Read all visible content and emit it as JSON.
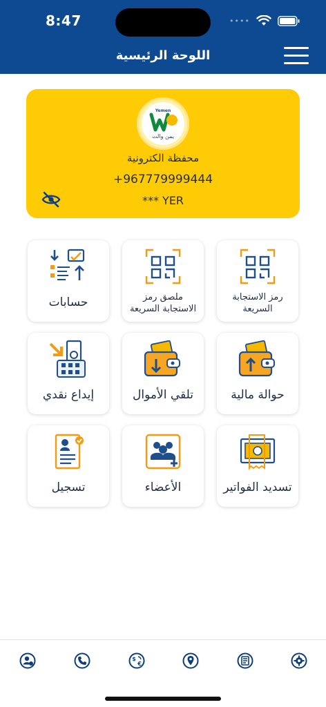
{
  "status_bar": {
    "time": "8:47"
  },
  "header": {
    "title": "اللوحة الرئيسية",
    "menu_icon": "hamburger-menu-icon"
  },
  "wallet": {
    "logo_text_top": "Yemen",
    "logo_text_bottom": "يمن والت",
    "type": "محفظة الكترونية",
    "phone": "+967779999444",
    "balance": "*** YER",
    "toggle_icon": "eye-off-icon"
  },
  "services": [
    {
      "id": "qr-code",
      "label": "رمز الاستجابة السريعة",
      "icon": "qr-scan-icon"
    },
    {
      "id": "qr-sticker",
      "label": "ملصق رمز الاستجابة السريعة",
      "icon": "qr-scan-icon"
    },
    {
      "id": "accounts",
      "label": "حسابات",
      "icon": "accounts-icon"
    },
    {
      "id": "transfer",
      "label": "حوالة مالية",
      "icon": "send-money-icon"
    },
    {
      "id": "receive",
      "label": "تلقي الأموال",
      "icon": "receive-money-icon"
    },
    {
      "id": "deposit",
      "label": "إيداع نقدي",
      "icon": "cash-deposit-icon"
    },
    {
      "id": "bills",
      "label": "تسديد الفواتير",
      "icon": "bill-payment-icon"
    },
    {
      "id": "members",
      "label": "الأعضاء",
      "icon": "members-icon"
    },
    {
      "id": "register",
      "label": "تسجيل",
      "icon": "register-icon"
    }
  ],
  "bottom_nav": [
    {
      "icon": "profile-icon"
    },
    {
      "icon": "phone-support-icon"
    },
    {
      "icon": "currency-exchange-icon"
    },
    {
      "icon": "location-pin-icon"
    },
    {
      "icon": "statements-icon"
    },
    {
      "icon": "settings-gear-icon"
    }
  ],
  "colors": {
    "primary": "#0d4a91",
    "accent": "#ffcb05",
    "orange": "#f39c12",
    "text": "#1f2a44"
  }
}
